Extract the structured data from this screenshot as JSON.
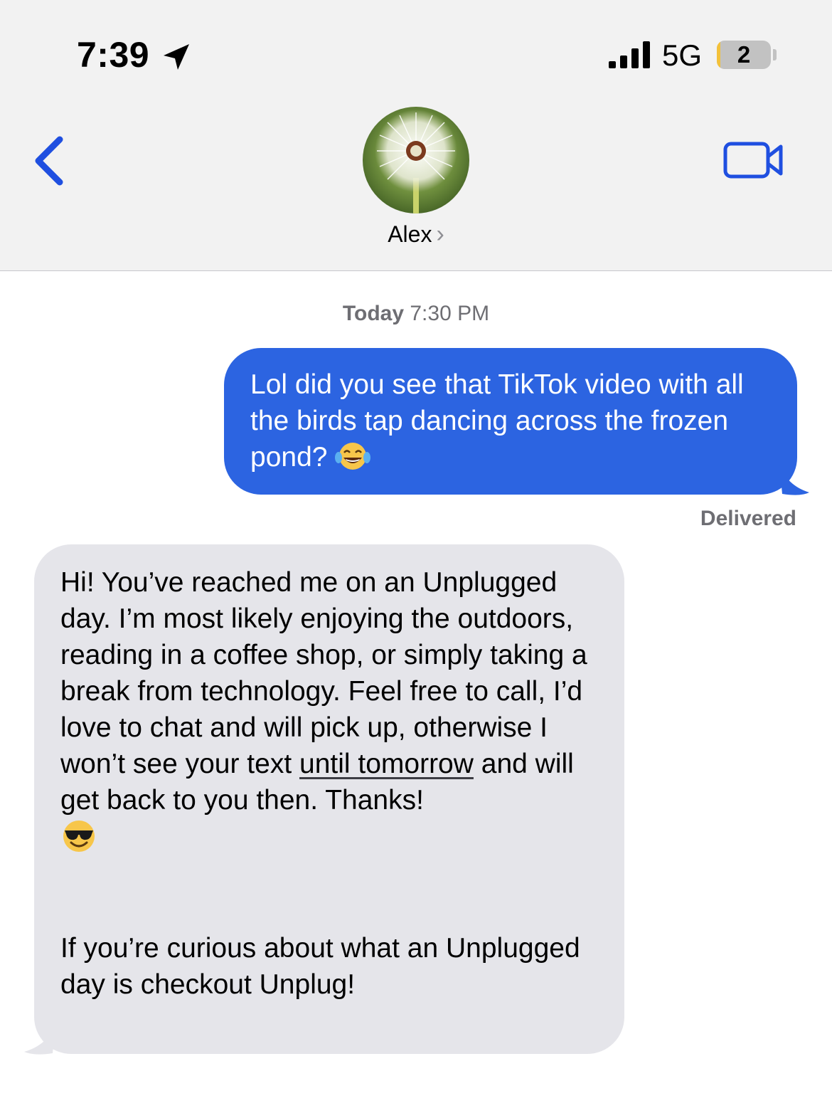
{
  "status_bar": {
    "time": "7:39",
    "location_icon": "location-arrow-icon",
    "signal_icon": "cellular-signal-icon",
    "network": "5G",
    "battery_level": "2",
    "battery_fraction": 0.02,
    "battery_color": "#f3c13a"
  },
  "header": {
    "back_icon": "chevron-left-icon",
    "video_icon": "video-camera-icon",
    "avatar_icon": "dandelion-avatar",
    "contact_name": "Alex",
    "contact_chevron": "›"
  },
  "conversation": {
    "timestamp_day": "Today",
    "timestamp_time": "7:30 PM",
    "outgoing": {
      "text": "Lol did you see that TikTok video with all the birds tap dancing across the frozen pond?",
      "emoji": "face-with-tears-of-joy",
      "color": "#2c64e1"
    },
    "delivery_status": "Delivered",
    "incoming": {
      "text_before_link": "Hi! You’ve reached me on an Unplugged day. I’m most likely enjoying the outdoors, reading in a coffee shop, or simply taking a break from technology. Feel free to call, I’d love to chat and will pick up, otherwise I won’t see your text ",
      "link_text": "until tomorrow",
      "text_after_link": " and will get back to you then. Thanks!",
      "emoji": "smiling-face-with-sunglasses",
      "footer_text": "If you’re curious about what an Unplugged day is checkout Unplug!",
      "color": "#e5e5ea"
    }
  }
}
